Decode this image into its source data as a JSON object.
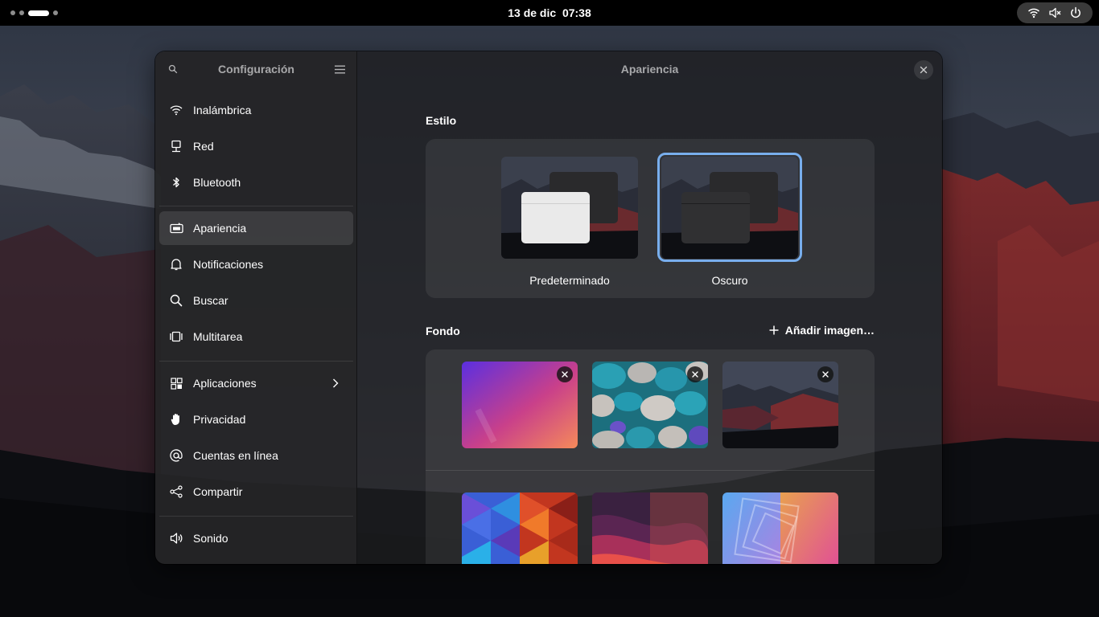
{
  "topbar": {
    "date": "13 de dic",
    "time": "07:38",
    "workspaces_count": 4,
    "active_workspace": 3
  },
  "sidebar": {
    "title": "Configuración",
    "search_icon": "search-icon",
    "menu_icon": "hamburger-menu-icon",
    "items": [
      {
        "label": "Inalámbrica",
        "icon": "wifi-icon"
      },
      {
        "label": "Red",
        "icon": "network-icon"
      },
      {
        "label": "Bluetooth",
        "icon": "bluetooth-icon"
      },
      {
        "label": "Apariencia",
        "icon": "appearance-icon",
        "selected": true
      },
      {
        "label": "Notificaciones",
        "icon": "bell-icon"
      },
      {
        "label": "Buscar",
        "icon": "search-icon"
      },
      {
        "label": "Multitarea",
        "icon": "multitasking-icon"
      },
      {
        "label": "Aplicaciones",
        "icon": "apps-grid-icon",
        "has_submenu": true
      },
      {
        "label": "Privacidad",
        "icon": "hand-icon"
      },
      {
        "label": "Cuentas en línea",
        "icon": "at-icon"
      },
      {
        "label": "Compartir",
        "icon": "share-icon"
      },
      {
        "label": "Sonido",
        "icon": "speaker-icon"
      }
    ]
  },
  "content": {
    "title": "Apariencia",
    "style": {
      "heading": "Estilo",
      "options": [
        {
          "label": "Predeterminado",
          "selected": false
        },
        {
          "label": "Oscuro",
          "selected": true
        }
      ]
    },
    "background": {
      "heading": "Fondo",
      "add_label": "Añadir imagen…"
    }
  },
  "colors": {
    "accent": "#78aeed",
    "topbar": "#000000",
    "sidebar_bg": "#242426",
    "window_bg": "#1e1e20"
  }
}
